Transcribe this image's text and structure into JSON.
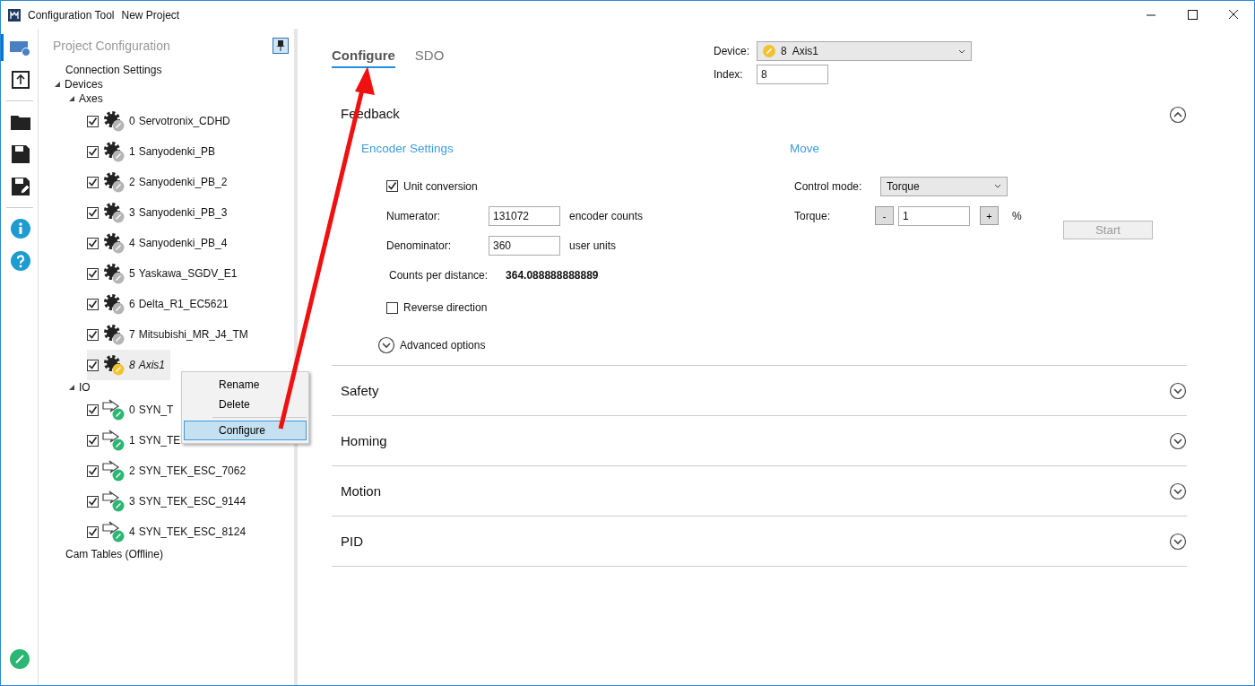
{
  "window": {
    "title": "Configuration Tool",
    "project": "New Project"
  },
  "rail": [
    {
      "kind": "network",
      "selected": true
    },
    {
      "kind": "upload",
      "selected": false
    },
    {
      "kind": "folder",
      "selected": false
    },
    {
      "kind": "save",
      "selected": false
    },
    {
      "kind": "save-as",
      "selected": false
    },
    {
      "kind": "info",
      "selected": false
    },
    {
      "kind": "help",
      "selected": false
    }
  ],
  "panel": {
    "title": "Project Configuration",
    "pinned": true
  },
  "tree": [
    {
      "label": "Connection Settings"
    },
    {
      "label": "Devices",
      "expanded": true,
      "children": [
        {
          "label": "Axes",
          "expanded": true,
          "children": [
            {
              "index": "0",
              "label": "Servotronix_CDHD",
              "kind": "axis",
              "color": "#b5b5b5",
              "italic": false,
              "checked": true,
              "selected": false
            },
            {
              "index": "1",
              "label": "Sanyodenki_PB",
              "kind": "axis",
              "color": "#b5b5b5",
              "italic": false,
              "checked": true,
              "selected": false
            },
            {
              "index": "2",
              "label": "Sanyodenki_PB_2",
              "kind": "axis",
              "color": "#b5b5b5",
              "italic": false,
              "checked": true,
              "selected": false
            },
            {
              "index": "3",
              "label": "Sanyodenki_PB_3",
              "kind": "axis",
              "color": "#b5b5b5",
              "italic": false,
              "checked": true,
              "selected": false
            },
            {
              "index": "4",
              "label": "Sanyodenki_PB_4",
              "kind": "axis",
              "color": "#b5b5b5",
              "italic": false,
              "checked": true,
              "selected": false
            },
            {
              "index": "5",
              "label": "Yaskawa_SGDV_E1",
              "kind": "axis",
              "color": "#b5b5b5",
              "italic": false,
              "checked": true,
              "selected": false
            },
            {
              "index": "6",
              "label": "Delta_R1_EC5621",
              "kind": "axis",
              "color": "#b5b5b5",
              "italic": false,
              "checked": true,
              "selected": false
            },
            {
              "index": "7",
              "label": "Mitsubishi_MR_J4_TM",
              "kind": "axis",
              "color": "#b5b5b5",
              "italic": false,
              "checked": true,
              "selected": false
            },
            {
              "index": "8",
              "label": "Axis1",
              "kind": "axis",
              "color": "#f2c230",
              "italic": true,
              "checked": true,
              "selected": true
            }
          ]
        },
        {
          "label": "IO",
          "expanded": true,
          "children": [
            {
              "index": "0",
              "label": "SYN_T",
              "kind": "io",
              "color": "#2bb673",
              "italic": false,
              "checked": true,
              "selected": false
            },
            {
              "index": "1",
              "label": "SYN_TE",
              "kind": "io",
              "color": "#2bb673",
              "italic": false,
              "checked": true,
              "selected": false
            },
            {
              "index": "2",
              "label": "SYN_TEK_ESC_7062",
              "kind": "io",
              "color": "#2bb673",
              "italic": false,
              "checked": true,
              "selected": false
            },
            {
              "index": "3",
              "label": "SYN_TEK_ESC_9144",
              "kind": "io",
              "color": "#2bb673",
              "italic": false,
              "checked": true,
              "selected": false
            },
            {
              "index": "4",
              "label": "SYN_TEK_ESC_8124",
              "kind": "io",
              "color": "#2bb673",
              "italic": false,
              "checked": true,
              "selected": false
            }
          ]
        }
      ]
    },
    {
      "label": "Cam Tables (Offline)"
    }
  ],
  "context_menu": [
    {
      "label": "Rename",
      "selected": false
    },
    {
      "label": "Delete",
      "selected": false
    },
    {
      "label": "Configure",
      "selected": true
    }
  ],
  "tabs": [
    {
      "label": "Configure",
      "selected": true
    },
    {
      "label": "SDO",
      "selected": false
    }
  ],
  "device": {
    "label": "Device:",
    "index": "8",
    "name": "Axis1",
    "index_label": "Index:",
    "index_value": "8"
  },
  "sections": [
    {
      "title": "Feedback",
      "expanded": true
    },
    {
      "title": "Safety",
      "expanded": false
    },
    {
      "title": "Homing",
      "expanded": false
    },
    {
      "title": "Motion",
      "expanded": false
    },
    {
      "title": "PID",
      "expanded": false
    }
  ],
  "encoder": {
    "title": "Encoder Settings",
    "unit_conversion": {
      "label": "Unit conversion",
      "checked": true
    },
    "numerator": {
      "label": "Numerator:",
      "value": "131072",
      "unit": "encoder counts"
    },
    "denominator": {
      "label": "Denominator:",
      "value": "360",
      "unit": "user units"
    },
    "counts": {
      "label": "Counts per distance:",
      "value": "364.088888888889"
    },
    "reverse": {
      "label": "Reverse direction",
      "checked": false
    },
    "advanced": "Advanced options"
  },
  "move": {
    "title": "Move",
    "control_mode_label": "Control mode:",
    "control_mode": "Torque",
    "torque_label": "Torque:",
    "minus": "-",
    "torque_value": "1",
    "plus": "+",
    "unit": "%",
    "start": "Start",
    "start_disabled": true
  }
}
